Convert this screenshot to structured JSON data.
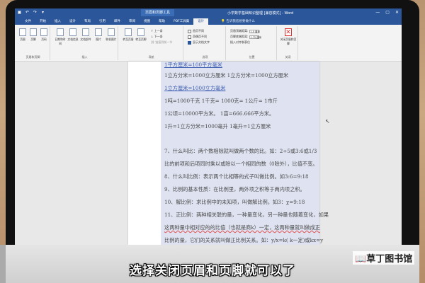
{
  "titlebar": {
    "context_title": "页眉和页脚工具",
    "doc_title": "小学数学基础知识整理 [兼容模式] - Word",
    "qat": [
      "save",
      "undo",
      "redo",
      "customize"
    ],
    "controls": [
      "minimize",
      "maximize",
      "close"
    ]
  },
  "tabs": [
    "文件",
    "开始",
    "插入",
    "设计",
    "布局",
    "引用",
    "邮件",
    "审阅",
    "视图",
    "帮助",
    "PDF工具集",
    "设计"
  ],
  "active_tab_index": 11,
  "tell_me": "告诉我您想要做什么",
  "ribbon": {
    "group1": {
      "buttons": [
        "页眉",
        "页脚",
        "页码"
      ],
      "label": "页眉和页脚"
    },
    "group2": {
      "buttons": [
        "日期和时间",
        "文档信息",
        "文档部件",
        "图片",
        "联机图片"
      ],
      "label": "插入"
    },
    "group3": {
      "buttons": [
        "转至页眉",
        "转至页脚"
      ],
      "small": [
        "上一条",
        "下一条",
        "链接到前一节"
      ],
      "label": "导航"
    },
    "group4": {
      "options": [
        "首页不同",
        "奇偶页不同",
        "显示文档文字"
      ],
      "label": "选项"
    },
    "group5": {
      "rows": [
        "页眉顶端距离:",
        "页脚底端距离:",
        "插入对齐制表位"
      ],
      "values": [
        "1.5 厘米",
        "1.75 厘米"
      ],
      "label": "位置"
    },
    "group6": {
      "button": "关闭页眉和页脚",
      "label": "关闭"
    }
  },
  "doc_lines": [
    "1平方厘米=100平方毫米",
    "1立方分米=1000立方厘米 1立方分米=1000立方厘米",
    "1立方厘米=1000立方毫米",
    "1吨=1000千克 1千克= 1000克= 1公斤= 1市斤",
    "1公顷=10000平方米。 1亩=666.666平方米。",
    "1升=1立方分米=1000毫升 1毫升=1立方厘米",
    "7、什么叫比：两个数相除就叫做两个数的比。如：2÷5或3:6或1/3",
    "比的前项和后项同时乘以或除以一个相同的数（0除外），比值不变。",
    "8、什么叫比例：表示两个比相等的式子叫做比例。如3:6=9:18",
    "9、比例的基本性质：在比例里，两外项之积等于两内项之积。",
    "10、解比例：求比例中的未知项，叫做解比例。如3：χ=9:18",
    "11、正比例：两种相关联的量，一种量变化，另一种量也随着变化，如果",
    "这两种量中相对应的的比值（也就是商k）一定，这两种量就叫做成正",
    "比例的量，它们的关系就叫做正比例关系。如：y/x=k( k一定)或kx=y"
  ],
  "subtitle": "选择关闭页眉和页脚就可以了",
  "watermark": "草丁图书馆"
}
